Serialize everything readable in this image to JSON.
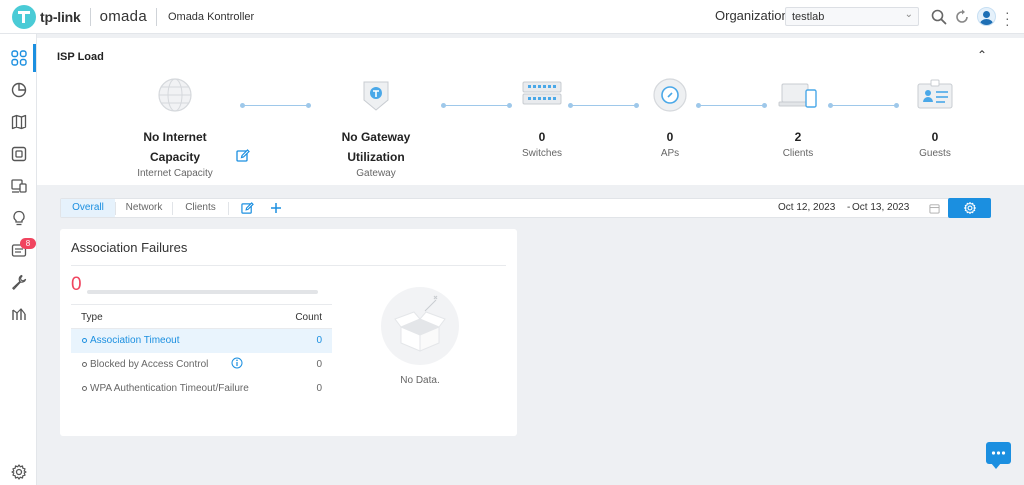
{
  "brand": {
    "company": "tp-link",
    "product": "omada",
    "app_name": "Omada Kontroller"
  },
  "header": {
    "org_label": "Organization:",
    "org_value": "testlab"
  },
  "sidebar": {
    "alerts_badge": "8"
  },
  "isp": {
    "title": "ISP Load",
    "nodes": [
      {
        "value": "No Internet Capacity",
        "label": "Internet Capacity"
      },
      {
        "value": "No Gateway Utilization",
        "label": "Gateway"
      },
      {
        "value": "0",
        "label": "Switches"
      },
      {
        "value": "0",
        "label": "APs"
      },
      {
        "value": "2",
        "label": "Clients"
      },
      {
        "value": "0",
        "label": "Guests"
      }
    ]
  },
  "tabs": {
    "items": [
      "Overall",
      "Network",
      "Clients"
    ],
    "active": "Overall"
  },
  "date_range": {
    "start": "Oct 12, 2023",
    "end": "Oct 13, 2023",
    "separator": "-"
  },
  "association_failures": {
    "title": "Association Failures",
    "total": "0",
    "columns": [
      "Type",
      "Count"
    ],
    "rows": [
      {
        "type": "Association Timeout",
        "count": "0"
      },
      {
        "type": "Blocked by Access Control",
        "count": "0"
      },
      {
        "type": "WPA Authentication Timeout/Failure",
        "count": "0"
      }
    ],
    "empty_text": "No Data."
  },
  "colors": {
    "accent": "#1b8fe0",
    "danger": "#f0455f",
    "background": "#eef0f3"
  }
}
